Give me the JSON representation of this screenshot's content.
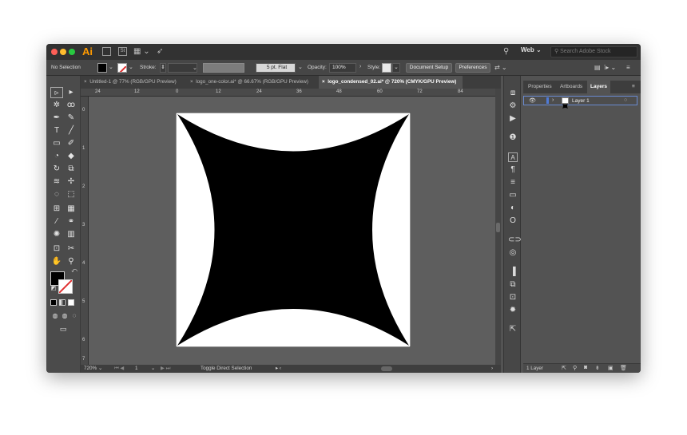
{
  "app": {
    "logo": "Ai",
    "workspace": "Web",
    "search_placeholder": "Search Adobe Stock"
  },
  "control_bar": {
    "selection": "No Selection",
    "stroke_label": "Stroke:",
    "brush_value": "5 pt. Flat",
    "opacity_label": "Opacity:",
    "opacity_value": "100%",
    "style_label": "Style:",
    "document_setup": "Document Setup",
    "preferences": "Preferences"
  },
  "tabs": [
    {
      "label": "Untitled-1 @ 77% (RGB/GPU Preview)",
      "close": "×"
    },
    {
      "label": "logo_one-color.ai* @ 66.67% (RGB/GPU Preview)",
      "close": "×"
    },
    {
      "label": "logo_condensed_02.ai* @ 720% (CMYK/GPU Preview)",
      "close": "×"
    }
  ],
  "ruler": {
    "horizontal": [
      "24",
      "12",
      "0",
      "12",
      "24",
      "36",
      "48",
      "60",
      "72",
      "84"
    ],
    "vertical": [
      "0",
      "1",
      "2",
      "3",
      "4",
      "5",
      "6",
      "7"
    ]
  },
  "status_bar": {
    "zoom": "720%",
    "artboard_number": "1",
    "status_text": "Toggle Direct Selection"
  },
  "layers_panel": {
    "tabs": [
      "Properties",
      "Artboards",
      "Layers"
    ],
    "active_tab": "Layers",
    "layers": [
      {
        "name": "Layer 1",
        "color": "#4f7bd8"
      }
    ],
    "footer_count": "1 Layer"
  },
  "colors": {
    "accent": "#ff9a00",
    "fill": "#000000",
    "stroke": "#ffffff",
    "artwork": "#000000",
    "artboard": "#ffffff"
  }
}
